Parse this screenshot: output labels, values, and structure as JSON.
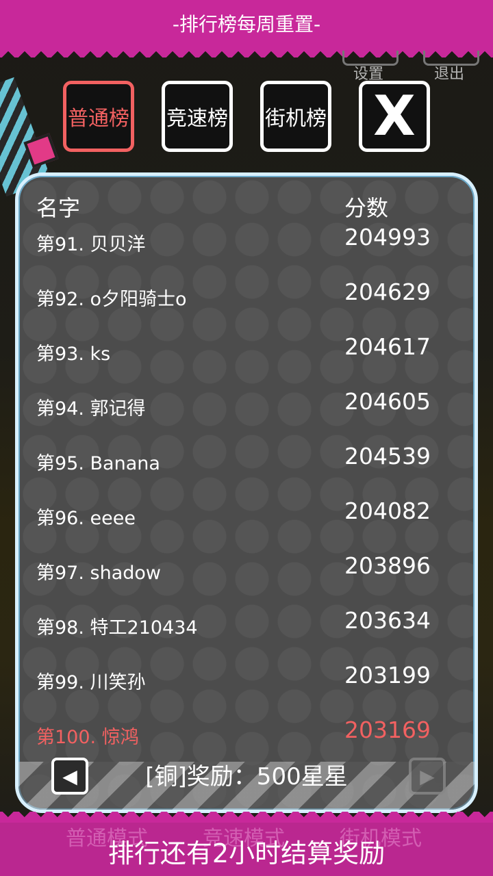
{
  "top_banner": {
    "text": "-排行榜每周重置-"
  },
  "hud": {
    "settings_label": "设置",
    "exit_label": "退出"
  },
  "tabs": [
    {
      "label": "普通榜",
      "active": true
    },
    {
      "label": "竞速榜",
      "active": false
    },
    {
      "label": "街机榜",
      "active": false
    }
  ],
  "close_button": {
    "label": "X"
  },
  "leaderboard": {
    "header_name": "名字",
    "header_score": "分数",
    "rows": [
      {
        "name": "第91. 贝贝洋",
        "score": "204993"
      },
      {
        "name": "第92. o夕阳骑士o",
        "score": "204629"
      },
      {
        "name": "第93. ks",
        "score": "204617"
      },
      {
        "name": "第94. 郭记得",
        "score": "204605"
      },
      {
        "name": "第95. Banana",
        "score": "204539"
      },
      {
        "name": "第96. eeee",
        "score": "204082"
      },
      {
        "name": "第97. shadow",
        "score": "203896"
      },
      {
        "name": "第98. 特工210434",
        "score": "203634"
      },
      {
        "name": "第99. 川笑孙",
        "score": "203199"
      },
      {
        "name": "第100. 惊鸿",
        "score": "203169",
        "highlight": true
      }
    ],
    "reward_text": "[铜]奖励：500星星",
    "prev_icon": "◀",
    "next_icon": "▶"
  },
  "background_buttons": {
    "normal": "普通模式",
    "speed": "竞速模式",
    "arcade": "街机模式"
  },
  "bottom_banner": {
    "text": "排行还有2小时结算奖励"
  },
  "colors": {
    "accent": "#c8289a",
    "highlight": "#f26161",
    "panel": "#4c4c4c",
    "panel_border": "#d8f0ff"
  }
}
